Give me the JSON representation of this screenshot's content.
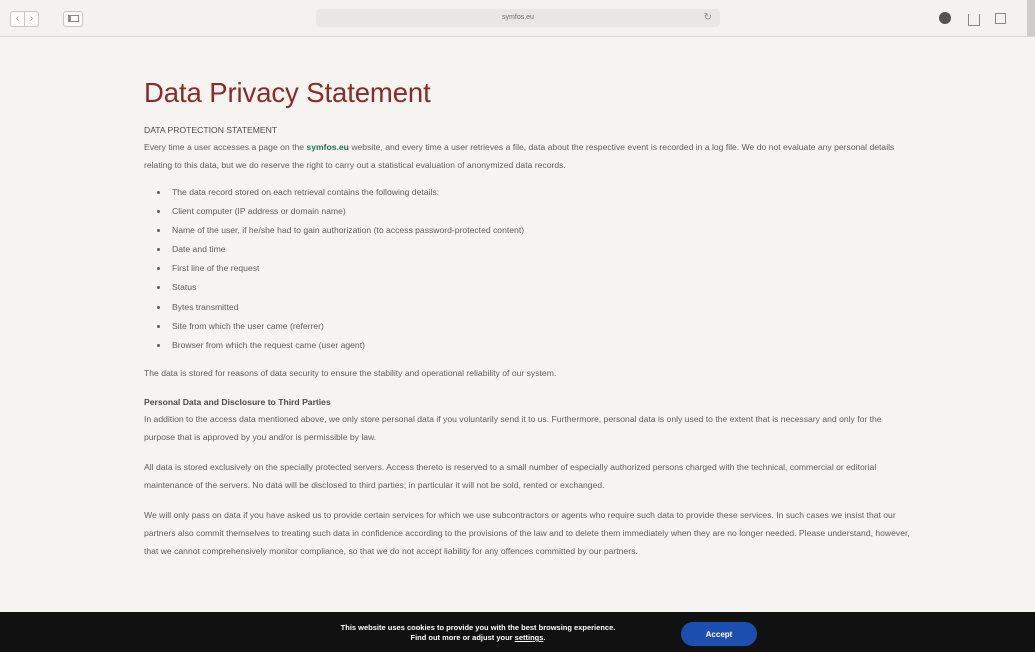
{
  "browser": {
    "url": "symfos.eu",
    "back_glyph": "‹",
    "forward_glyph": "›",
    "reload_glyph": "↻"
  },
  "page": {
    "title": "Data Privacy Statement",
    "section1": {
      "heading": "DATA PROTECTION STATEMENT",
      "text_before_link": "Every time a user accesses a page on the ",
      "link": "symfos.eu",
      "text_after_link": " website, and every time a user retrieves a file, data about the respective event is recorded in a log file. We do not evaluate any personal details relating to this data, but we do reserve the right to carry out a statistical evaluation of anonymized data records."
    },
    "list_items": [
      "The data record stored on each retrieval contains the following details:",
      "Client computer (IP address or domain name)",
      "Name of the user, if he/she had to gain authorization (to access password-protected content)",
      "Date and time",
      "First line of the request",
      "Status",
      "Bytes transmitted",
      "Site from which the user came (referrer)",
      "Browser from which the request came (user agent)"
    ],
    "security_paragraph": "The data is stored for reasons of data security to ensure the stability and operational reliability of our system.",
    "section2": {
      "heading": "Personal Data and Disclosure to Third Parties",
      "paragraph1": "In addition to the access data mentioned above, we only store personal data if you voluntarily send it to us. Furthermore, personal data is only used to the extent that is necessary and only for the purpose that is approved by you and/or is permissible by law.",
      "paragraph2": "All data is stored exclusively on the specially protected servers. Access thereto is reserved to a small number of especially authorized persons charged with the technical, commercial or editorial maintenance of the servers. No data will be disclosed to third parties; in particular it will not be sold, rented or exchanged.",
      "paragraph3": "We will only pass on data if you have asked us to provide certain services for which we use subcontractors or agents who require such data to provide these services. In such cases we insist that our partners also commit themselves to treating such data in confidence according to the provisions of the law and to delete them immediately when they are no longer needed. Please understand, however, that we cannot comprehensively monitor compliance, so that we do not accept liability for any offences committed by our partners."
    }
  },
  "cookie_bar": {
    "line1": "This website uses cookies to provide you with the best browsing experience.",
    "line2_prefix": "Find out more or adjust your ",
    "settings_link": "settings",
    "line2_suffix": ".",
    "accept_label": "Accept"
  }
}
